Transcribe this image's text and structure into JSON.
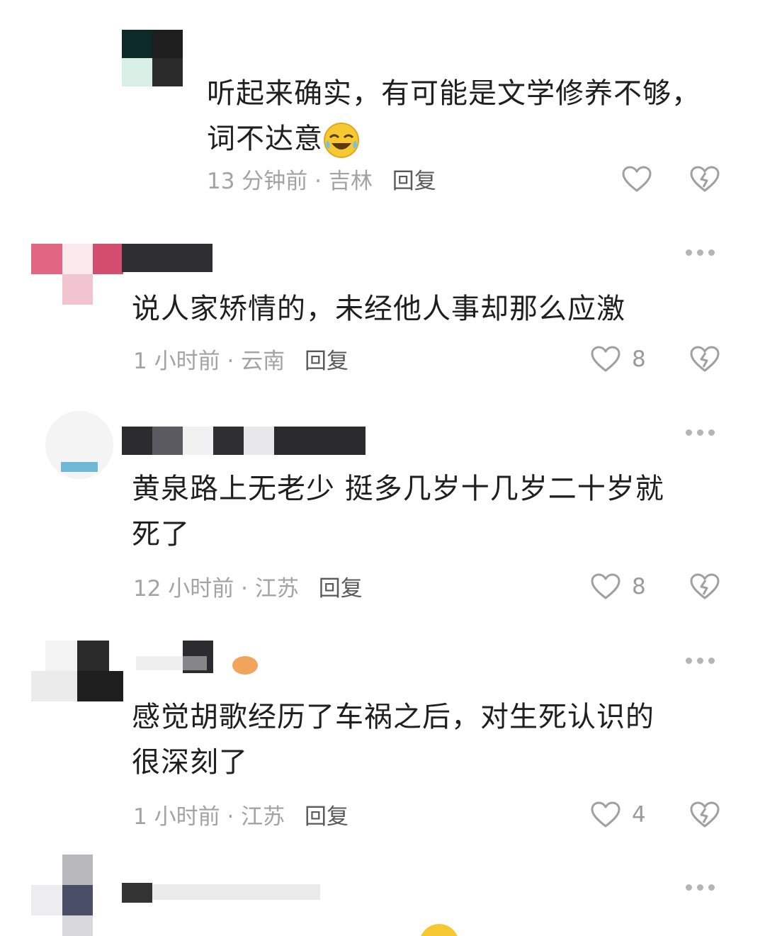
{
  "comments": [
    {
      "text_lines": [
        "听起来确实，有可能是文学修养不够，",
        "词不达意"
      ],
      "emoji": "laughing-crying-emoji",
      "time": "13 分钟前",
      "location": "吉林",
      "reply_label": "回复",
      "likes": ""
    },
    {
      "text_lines": [
        "说人家矫情的，未经他人事却那么应激"
      ],
      "time": "1 小时前",
      "location": "云南",
      "reply_label": "回复",
      "likes": "8"
    },
    {
      "text_lines": [
        "黄泉路上无老少 挺多几岁十几岁二十岁就",
        "死了"
      ],
      "time": "12 小时前",
      "location": "江苏",
      "reply_label": "回复",
      "likes": "8"
    },
    {
      "text_lines": [
        "感觉胡歌经历了车祸之后，对生死认识的",
        "很深刻了"
      ],
      "time": "1 小时前",
      "location": "江苏",
      "reply_label": "回复",
      "likes": "4"
    },
    {
      "text_lines": [
        ""
      ],
      "time": "",
      "location": "",
      "reply_label": "",
      "likes": ""
    }
  ],
  "separator": "·",
  "icons": {
    "like": "heart-outline-icon",
    "dislike": "broken-heart-icon",
    "more": "more-dots-icon"
  },
  "colors": {
    "text": "#1f1f1f",
    "meta": "#a3a3a3",
    "reply": "#5a5a5a",
    "icon": "#a0a0a0"
  }
}
